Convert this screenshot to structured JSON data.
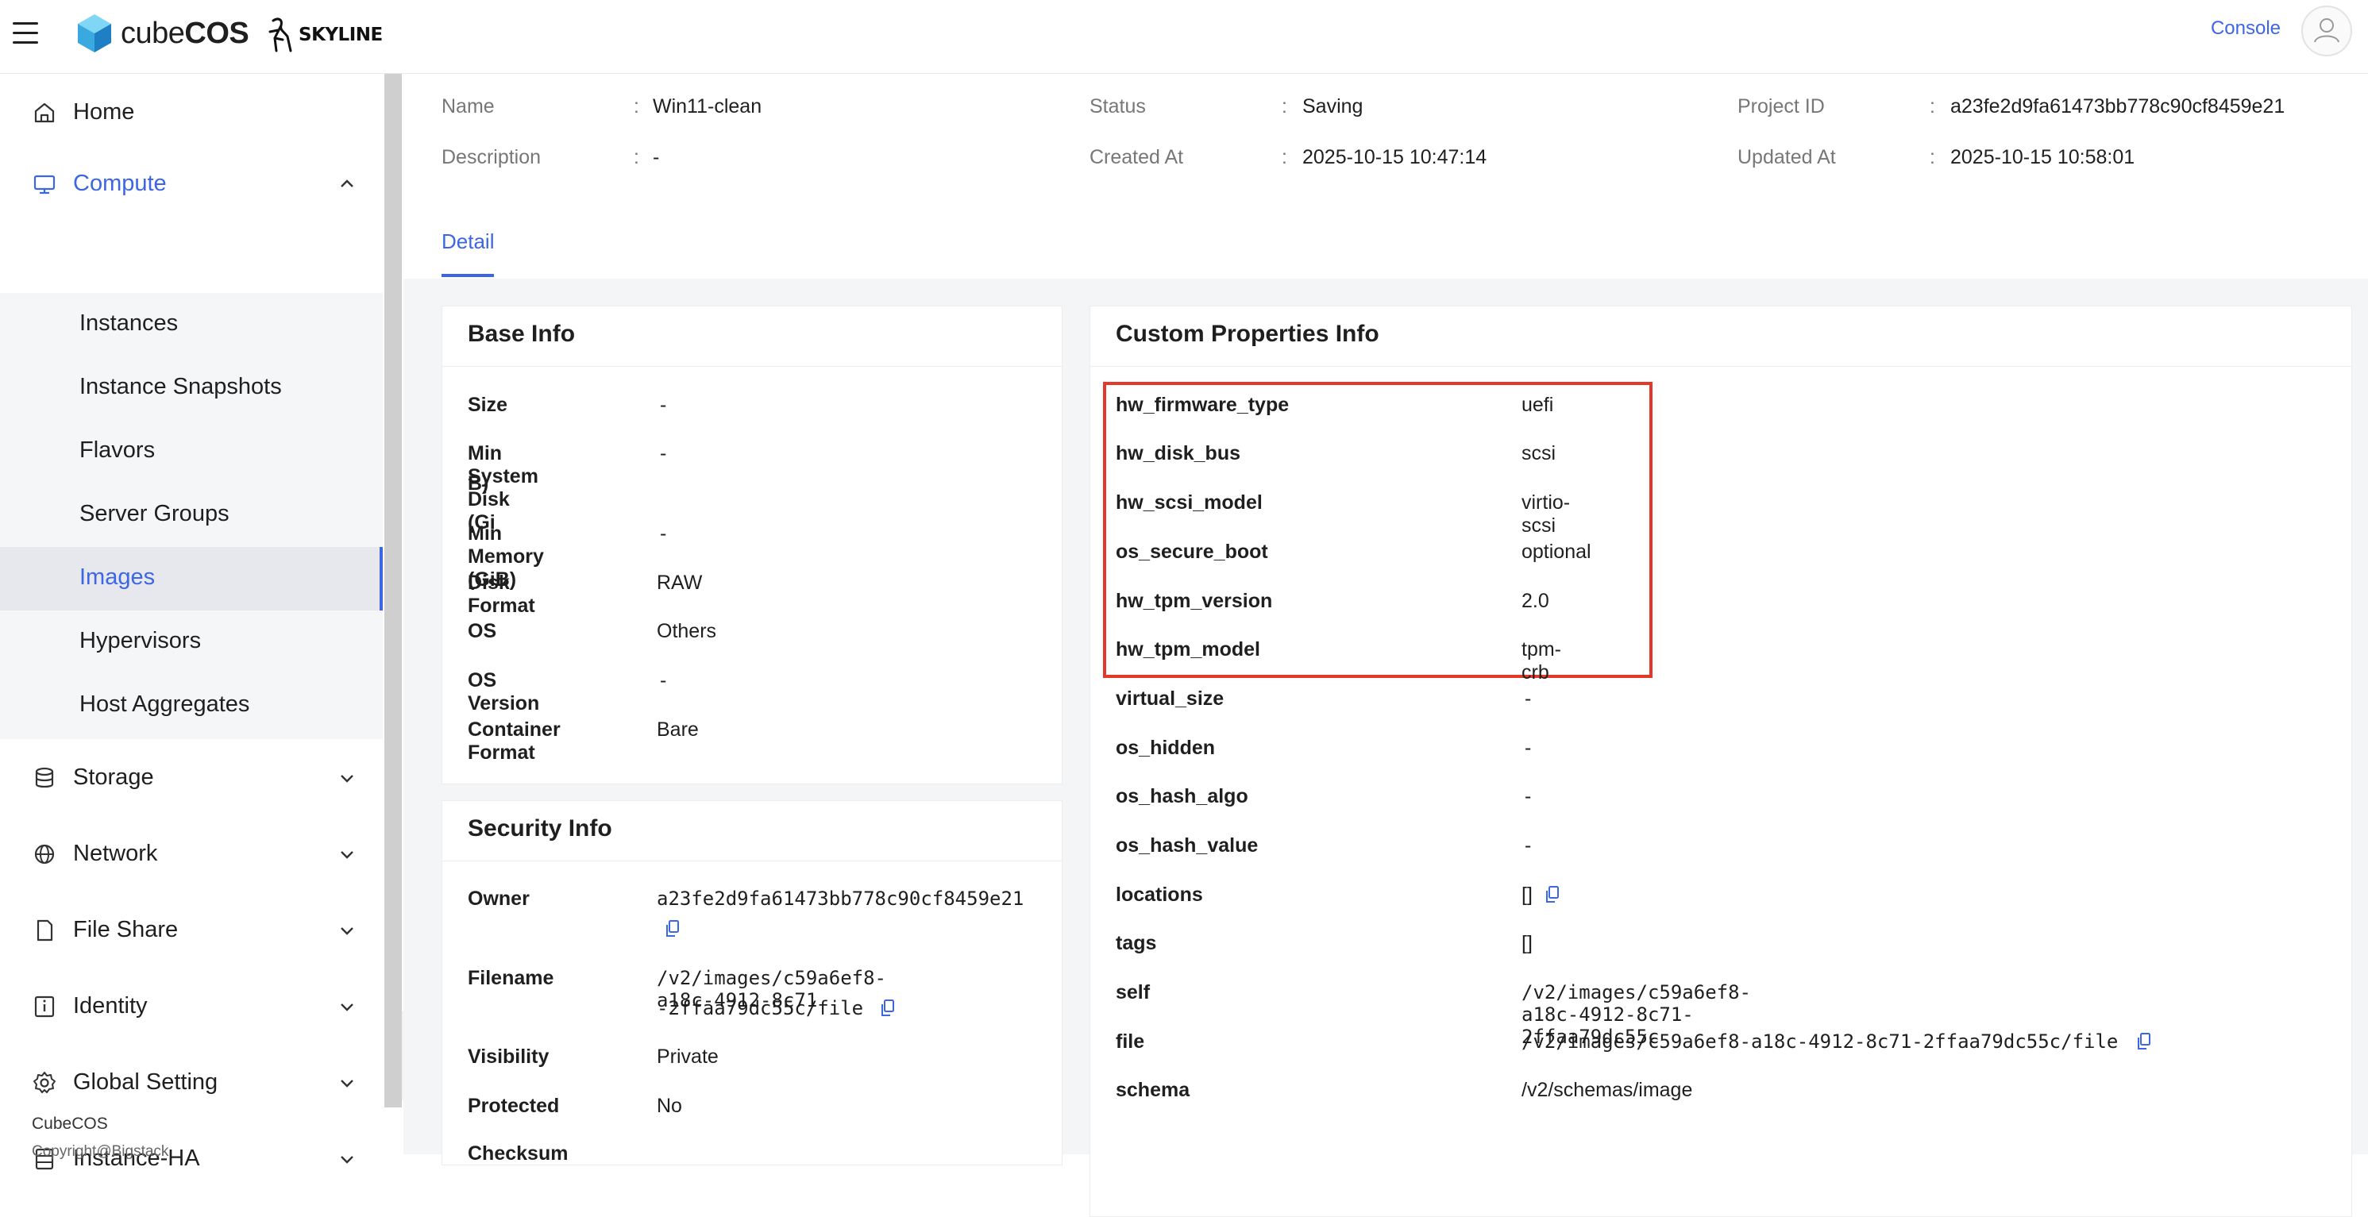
{
  "topbar": {
    "brand_prefix": "cube",
    "brand_suffix": "COS",
    "partner": "SKYLINE",
    "console_label": "Console"
  },
  "sidebar": {
    "home": "Home",
    "compute": "Compute",
    "compute_items": [
      "Instances",
      "Instance Snapshots",
      "Flavors",
      "Server Groups",
      "Images",
      "Hypervisors",
      "Host Aggregates"
    ],
    "storage": "Storage",
    "network": "Network",
    "file_share": "File Share",
    "identity": "Identity",
    "global_setting": "Global Setting",
    "instance_ha": "Instance-HA",
    "footer": "CubeCOS",
    "footer2": "Copyright@Bigstack"
  },
  "header": {
    "name_label": "Name",
    "name_value": "Win11-clean",
    "description_label": "Description",
    "description_value": "-",
    "status_label": "Status",
    "status_value": "Saving",
    "created_label": "Created At",
    "created_value": "2025-10-15 10:47:14",
    "project_label": "Project ID",
    "project_value": "a23fe2d9fa61473bb778c90cf8459e21",
    "updated_label": "Updated At",
    "updated_value": "2025-10-15 10:58:01",
    "sep": ":"
  },
  "tabs": {
    "detail": "Detail"
  },
  "base_info": {
    "title": "Base Info",
    "rows": [
      {
        "k": "Size",
        "v": "-"
      },
      {
        "k": "Min System Disk (Gi",
        "k2": "B)",
        "v": "-"
      },
      {
        "k": "Min Memory (GiB)",
        "v": "-"
      },
      {
        "k": "Disk Format",
        "v": "RAW"
      },
      {
        "k": "OS",
        "v": "Others"
      },
      {
        "k": "OS Version",
        "v": "-"
      },
      {
        "k": "Container Format",
        "v": "Bare"
      }
    ]
  },
  "security_info": {
    "title": "Security Info",
    "rows": [
      {
        "k": "Owner",
        "v": "a23fe2d9fa61473bb778c90cf8459e21"
      },
      {
        "k": "Filename",
        "v": "/v2/images/c59a6ef8-a18c-4912-8c71",
        "v2": "-2ffaa79dc55c/file"
      },
      {
        "k": "Visibility",
        "v": "Private"
      },
      {
        "k": "Protected",
        "v": "No"
      },
      {
        "k": "Checksum",
        "v": ""
      }
    ]
  },
  "custom_props": {
    "title": "Custom Properties Info",
    "rows": [
      {
        "k": "hw_firmware_type",
        "v": "uefi"
      },
      {
        "k": "hw_disk_bus",
        "v": "scsi"
      },
      {
        "k": "hw_scsi_model",
        "v": "virtio-scsi"
      },
      {
        "k": "os_secure_boot",
        "v": "optional"
      },
      {
        "k": "hw_tpm_version",
        "v": "2.0"
      },
      {
        "k": "hw_tpm_model",
        "v": "tpm-crb"
      },
      {
        "k": "virtual_size",
        "v": "-"
      },
      {
        "k": "os_hidden",
        "v": "-"
      },
      {
        "k": "os_hash_algo",
        "v": "-"
      },
      {
        "k": "os_hash_value",
        "v": "-"
      },
      {
        "k": "locations",
        "v": "[]"
      },
      {
        "k": "tags",
        "v": "[]"
      },
      {
        "k": "self",
        "v": "/v2/images/c59a6ef8-a18c-4912-8c71-2ffaa79dc55c"
      },
      {
        "k": "file",
        "v": "/v2/images/c59a6ef8-a18c-4912-8c71-2ffaa79dc55c/file"
      },
      {
        "k": "schema",
        "v": "/v2/schemas/image"
      }
    ],
    "highlight_color": "#e2392b"
  },
  "colors": {
    "accent": "#3d66e4"
  }
}
